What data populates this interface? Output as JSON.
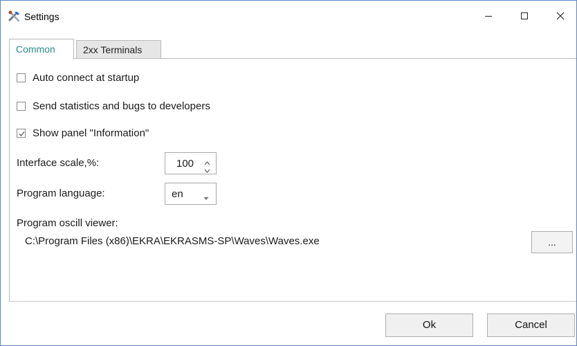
{
  "window": {
    "title": "Settings",
    "app_icon": "tools-icon",
    "controls": {
      "minimize": "minimize-icon",
      "maximize": "maximize-icon",
      "close": "close-icon"
    }
  },
  "tabs": [
    {
      "label": "Common",
      "active": true
    },
    {
      "label": "2xx Terminals",
      "active": false
    }
  ],
  "options": {
    "auto_connect": {
      "label": "Auto connect at startup",
      "checked": false
    },
    "send_statistics": {
      "label": "Send statistics and bugs to developers",
      "checked": false
    },
    "show_panel": {
      "label": "Show panel \"Information\"",
      "checked": true
    }
  },
  "interface_scale": {
    "label": "Interface scale,%:",
    "value": "100"
  },
  "program_language": {
    "label": "Program language:",
    "value": "en"
  },
  "oscill_viewer": {
    "label": "Program oscill viewer:",
    "path": "C:\\Program Files (x86)\\EKRA\\EKRASMS-SP\\Waves\\Waves.exe",
    "browse_label": "..."
  },
  "footer": {
    "ok_label": "Ok",
    "cancel_label": "Cancel"
  },
  "colors": {
    "active_tab_text": "#2a8a8f",
    "window_border": "#5b88c0"
  }
}
